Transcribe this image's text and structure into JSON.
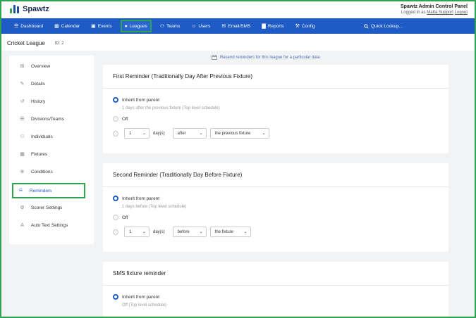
{
  "app": {
    "name": "Spawtz"
  },
  "panel": {
    "title": "Spawtz Admin Control Panel",
    "logged_prefix": "Logged In as",
    "user": "Matta Support",
    "logout": "Logout"
  },
  "nav": {
    "items": [
      {
        "label": "Dashboard",
        "icon": "dashboard-icon",
        "glyph": "☰"
      },
      {
        "label": "Calendar",
        "icon": "calendar-icon",
        "glyph": "▦"
      },
      {
        "label": "Events",
        "icon": "events-icon",
        "glyph": "▣"
      },
      {
        "label": "Leagues",
        "icon": "leagues-icon",
        "glyph": "●"
      },
      {
        "label": "Teams",
        "icon": "teams-icon",
        "glyph": "⚇"
      },
      {
        "label": "Users",
        "icon": "user-icon",
        "glyph": "☺"
      },
      {
        "label": "Email/SMS",
        "icon": "envelope-icon",
        "glyph": "✉"
      },
      {
        "label": "Reports",
        "icon": "reports-icon",
        "glyph": "▇"
      },
      {
        "label": "Config",
        "icon": "wrench-icon",
        "glyph": "⚒"
      }
    ],
    "active": "Leagues",
    "search_label": "Quick Lookup..."
  },
  "league": {
    "name": "Cricket League",
    "id_label": "ID: 2"
  },
  "sidebar": {
    "items": [
      {
        "label": "Overview",
        "glyph": "⊞"
      },
      {
        "label": "Details",
        "glyph": "✎"
      },
      {
        "label": "History",
        "glyph": "↺"
      },
      {
        "label": "Divisions/Teams",
        "glyph": "☰"
      },
      {
        "label": "Individuals",
        "glyph": "⚇"
      },
      {
        "label": "Fixtures",
        "glyph": "▦"
      },
      {
        "label": "Conditions",
        "glyph": "⊕"
      },
      {
        "label": "Reminders",
        "glyph": "⍾"
      },
      {
        "label": "Scorer Settings",
        "glyph": "⚙"
      },
      {
        "label": "Auto Text Settings",
        "glyph": "A"
      }
    ],
    "active": "Reminders"
  },
  "resend_link": "Resend reminders for this league for a particular date",
  "cards": [
    {
      "title": "First Reminder (Traditionally Day After Previous Fixture)",
      "inherit_label": "Inherit from parent",
      "inherit_note": "1 days after the previous fixture (Top level schedule)",
      "off_label": "Off",
      "count_value": "1",
      "unit_label": "day(s)",
      "direction_value": "after",
      "anchor_value": "the previous fixture"
    },
    {
      "title": "Second Reminder (Traditionally Day Before Fixture)",
      "inherit_label": "Inherit from parent",
      "inherit_note": "1 days before (Top level schedule)",
      "off_label": "Off",
      "count_value": "1",
      "unit_label": "day(s)",
      "direction_value": "before",
      "anchor_value": "the fixture"
    },
    {
      "title": "SMS fixture reminder",
      "inherit_label": "Inherit from parent",
      "inherit_note": "Off (Top level schedule)"
    }
  ]
}
